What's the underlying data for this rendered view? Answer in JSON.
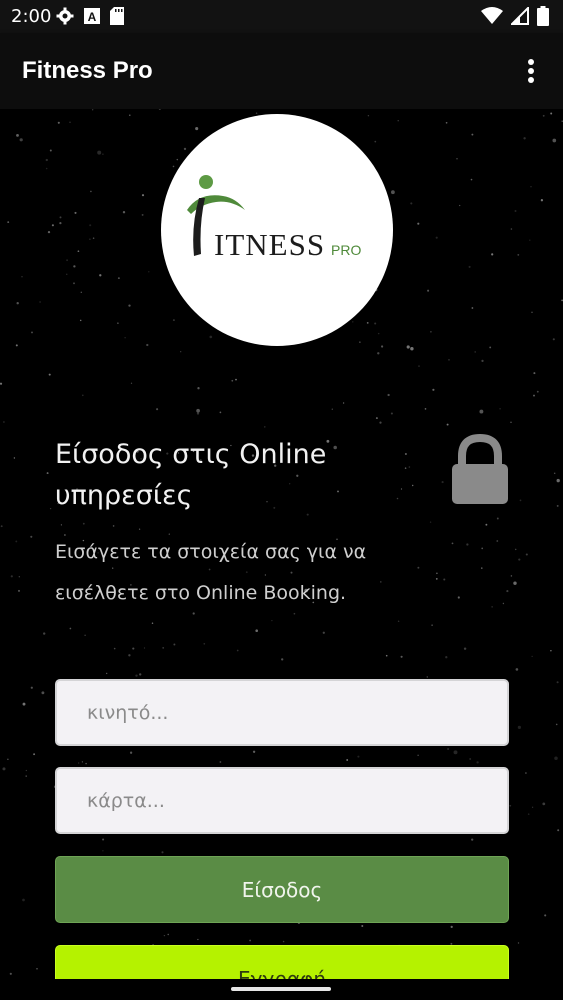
{
  "status_bar": {
    "time": "2:00",
    "left_icons": [
      "gear-icon",
      "a-badge-icon",
      "sd-card-icon"
    ],
    "right_icons": [
      "wifi-icon",
      "signal-icon",
      "battery-icon"
    ]
  },
  "app_bar": {
    "title": "Fitness Pro",
    "menu_icon": "more-vert-icon"
  },
  "logo": {
    "brand_main": "ITNESS",
    "brand_sub": "PRO",
    "accent_color": "#3f7a2e"
  },
  "login": {
    "title": "Είσοδος στις Online υπηρεσίες",
    "subtitle": "Εισάγετε τα στοιχεία σας για να εισέλθετε στο Online Booking.",
    "lock_icon": "lock-icon",
    "phone_placeholder": "κινητό...",
    "card_placeholder": "κάρτα...",
    "login_button": "Είσοδος",
    "register_button": "Εγγραφή"
  },
  "colors": {
    "login_button": "#5a8c45",
    "register_button": "#b5f200"
  }
}
